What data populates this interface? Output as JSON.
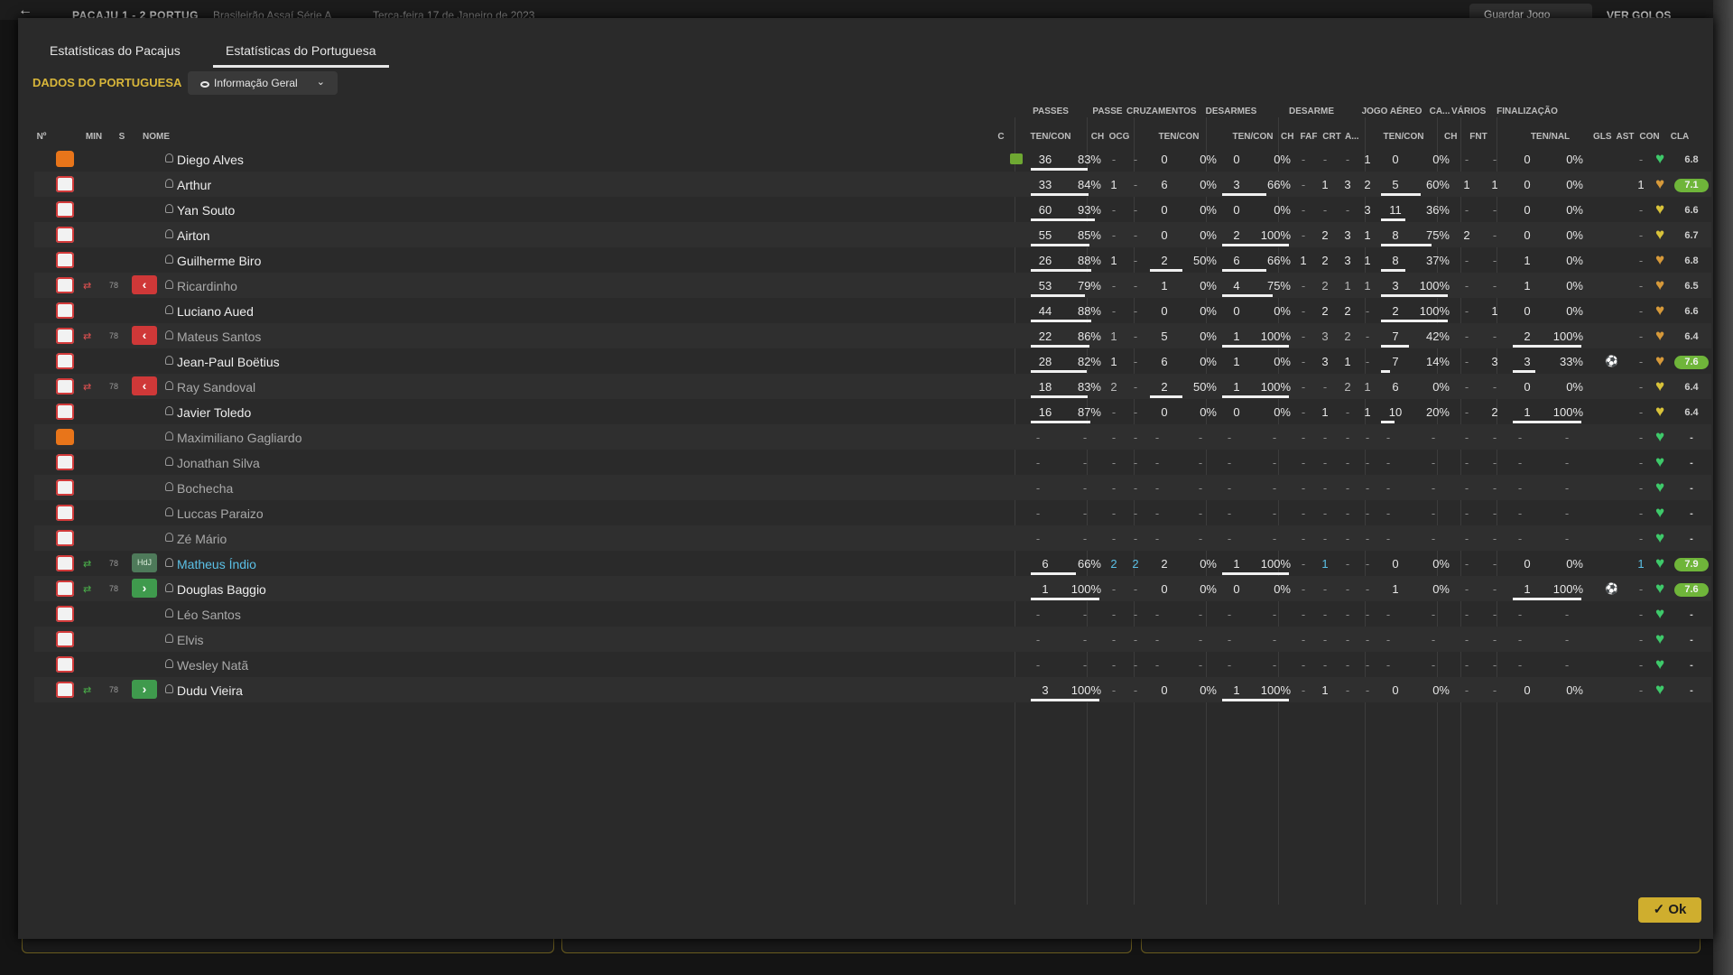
{
  "topbar": {
    "back_icon": "back-arrow-icon",
    "crumb": "PACAJU 1 - 2 PORTUG",
    "competition": "Brasileirão Assaí Série A",
    "date": "Terça-feira 17 de Janeiro de 2023",
    "save_label": "Guardar Jogo",
    "goals_label": "VER GOLOS"
  },
  "tabs": [
    {
      "label": "Estatísticas do Pacajus",
      "active": false
    },
    {
      "label": "Estatísticas do Portuguesa",
      "active": true
    }
  ],
  "team_label": "DADOS DO PORTUGUESA",
  "view_select": {
    "value": "Informação Geral"
  },
  "group_headers": [
    "PASSES",
    "PASSE",
    "CRUZAMENTOS",
    "DESARMES",
    "DESARME",
    "JOGO AÉREO",
    "CA...",
    "VÁRIOS",
    "FINALIZAÇÃO"
  ],
  "sub_headers": [
    "Nº",
    "MIN",
    "S",
    "NOME",
    "C",
    "TEN/CON",
    "CH",
    "OCG",
    "TEN/CON",
    "TEN/CON",
    "CH",
    "FAF",
    "CRT",
    "A...",
    "TEN/CON",
    "CH",
    "FNT",
    "TEN/NAL",
    "GLS",
    "AST",
    "CON",
    "CLA"
  ],
  "players": [
    {
      "name": "Diego Alves",
      "gk": true,
      "cond_icon": true,
      "pas": [
        "36",
        "83%",
        0.83
      ],
      "ch": "-",
      "ocg": "-",
      "cru": [
        "0",
        "0%",
        0
      ],
      "des": [
        "0",
        "0%",
        0
      ],
      "ds": [
        "-",
        "-",
        "-",
        "1"
      ],
      "aer": [
        "0",
        "0%",
        0
      ],
      "ca": "-",
      "fnt": "-",
      "fin": [
        "0",
        "0%",
        0
      ],
      "gls": "",
      "ast": "-",
      "heart": "g",
      "cla": "6.8"
    },
    {
      "name": "Arthur",
      "pas": [
        "33",
        "84%",
        0.84
      ],
      "ch": "1",
      "ocg": "-",
      "cru": [
        "6",
        "0%",
        0
      ],
      "des": [
        "3",
        "66%",
        0.66
      ],
      "ds": [
        "-",
        "1",
        "3",
        "2"
      ],
      "aer": [
        "5",
        "60%",
        0.6
      ],
      "ca": "1",
      "fnt": "1",
      "fin": [
        "0",
        "0%",
        0
      ],
      "gls": "",
      "ast": "1",
      "heart": "o",
      "cla": "7.1",
      "top": true
    },
    {
      "name": "Yan Souto",
      "pas": [
        "60",
        "93%",
        0.93
      ],
      "ch": "-",
      "ocg": "-",
      "cru": [
        "0",
        "0%",
        0
      ],
      "des": [
        "0",
        "0%",
        0
      ],
      "ds": [
        "-",
        "-",
        "-",
        "3"
      ],
      "aer": [
        "11",
        "36%",
        0.36
      ],
      "ca": "-",
      "fnt": "-",
      "fin": [
        "0",
        "0%",
        0
      ],
      "gls": "",
      "ast": "-",
      "heart": "y",
      "cla": "6.6"
    },
    {
      "name": "Airton",
      "pas": [
        "55",
        "85%",
        0.85
      ],
      "ch": "-",
      "ocg": "-",
      "cru": [
        "0",
        "0%",
        0
      ],
      "des": [
        "2",
        "100%",
        1
      ],
      "ds": [
        "-",
        "2",
        "3",
        "1"
      ],
      "aer": [
        "8",
        "75%",
        0.75
      ],
      "ca": "2",
      "fnt": "-",
      "fin": [
        "0",
        "0%",
        0
      ],
      "gls": "",
      "ast": "-",
      "heart": "y",
      "cla": "6.7"
    },
    {
      "name": "Guilherme Biro",
      "pas": [
        "26",
        "88%",
        0.88
      ],
      "ch": "1",
      "ocg": "-",
      "cru": [
        "2",
        "50%",
        0.5
      ],
      "des": [
        "6",
        "66%",
        0.66
      ],
      "ds": [
        "1",
        "2",
        "3",
        "1"
      ],
      "aer": [
        "8",
        "37%",
        0.37
      ],
      "ca": "-",
      "fnt": "-",
      "fin": [
        "1",
        "0%",
        0
      ],
      "gls": "",
      "ast": "-",
      "heart": "o",
      "cla": "6.8"
    },
    {
      "name": "Ricardinho",
      "dim": true,
      "sub": "out",
      "min": "78",
      "badge": "off",
      "pas": [
        "53",
        "79%",
        0.79
      ],
      "ch": "-",
      "ocg": "-",
      "cru": [
        "1",
        "0%",
        0
      ],
      "des": [
        "4",
        "75%",
        0.75
      ],
      "ds": [
        "-",
        "2",
        "1",
        "1"
      ],
      "aer": [
        "3",
        "100%",
        1
      ],
      "ca": "-",
      "fnt": "-",
      "fin": [
        "1",
        "0%",
        0
      ],
      "gls": "",
      "ast": "-",
      "heart": "o",
      "cla": "6.5"
    },
    {
      "name": "Luciano Aued",
      "pas": [
        "44",
        "88%",
        0.88
      ],
      "ch": "-",
      "ocg": "-",
      "cru": [
        "0",
        "0%",
        0
      ],
      "des": [
        "0",
        "0%",
        0
      ],
      "ds": [
        "-",
        "2",
        "2",
        "-"
      ],
      "aer": [
        "2",
        "100%",
        1
      ],
      "ca": "-",
      "fnt": "1",
      "fin": [
        "0",
        "0%",
        0
      ],
      "gls": "",
      "ast": "-",
      "heart": "o",
      "cla": "6.6"
    },
    {
      "name": "Mateus Santos",
      "dim": true,
      "sub": "out",
      "min": "78",
      "badge": "off",
      "pas": [
        "22",
        "86%",
        0.86
      ],
      "ch": "1",
      "ocg": "-",
      "cru": [
        "5",
        "0%",
        0
      ],
      "des": [
        "1",
        "100%",
        1
      ],
      "ds": [
        "-",
        "3",
        "2",
        "-"
      ],
      "aer": [
        "7",
        "42%",
        0.42
      ],
      "ca": "-",
      "fnt": "-",
      "fin": [
        "2",
        "100%",
        1
      ],
      "gls": "",
      "ast": "-",
      "heart": "o",
      "cla": "6.4"
    },
    {
      "name": "Jean-Paul Boëtius",
      "pas": [
        "28",
        "82%",
        0.82
      ],
      "ch": "1",
      "ocg": "-",
      "cru": [
        "6",
        "0%",
        0
      ],
      "des": [
        "1",
        "0%",
        0
      ],
      "ds": [
        "-",
        "3",
        "1",
        "-"
      ],
      "aer": [
        "7",
        "14%",
        0.14
      ],
      "ca": "-",
      "fnt": "3",
      "fin": [
        "3",
        "33%",
        0.33
      ],
      "gls": "⚽",
      "ast": "-",
      "heart": "o",
      "cla": "7.6",
      "top": true
    },
    {
      "name": "Ray Sandoval",
      "dim": true,
      "sub": "out",
      "min": "78",
      "badge": "off",
      "pas": [
        "18",
        "83%",
        0.83
      ],
      "ch": "2",
      "ocg": "-",
      "cru": [
        "2",
        "50%",
        0.5
      ],
      "des": [
        "1",
        "100%",
        1
      ],
      "ds": [
        "-",
        "-",
        "2",
        "1"
      ],
      "aer": [
        "6",
        "0%",
        0
      ],
      "ca": "-",
      "fnt": "-",
      "fin": [
        "0",
        "0%",
        0
      ],
      "gls": "",
      "ast": "-",
      "heart": "y",
      "cla": "6.4"
    },
    {
      "name": "Javier Toledo",
      "pas": [
        "16",
        "87%",
        0.87
      ],
      "ch": "-",
      "ocg": "-",
      "cru": [
        "0",
        "0%",
        0
      ],
      "des": [
        "0",
        "0%",
        0
      ],
      "ds": [
        "-",
        "1",
        "-",
        "1"
      ],
      "aer": [
        "10",
        "20%",
        0.2
      ],
      "ca": "-",
      "fnt": "2",
      "fin": [
        "1",
        "100%",
        1
      ],
      "gls": "",
      "ast": "-",
      "heart": "y",
      "cla": "6.4"
    },
    {
      "name": "Maximiliano Gagliardo",
      "gk": true,
      "dim": true,
      "empty": true,
      "heart": "g",
      "cla": "-"
    },
    {
      "name": "Jonathan Silva",
      "dim": true,
      "empty": true,
      "heart": "g",
      "cla": "-"
    },
    {
      "name": "Bochecha",
      "dim": true,
      "empty": true,
      "heart": "g",
      "cla": "-"
    },
    {
      "name": "Luccas Paraizo",
      "dim": true,
      "empty": true,
      "heart": "g",
      "cla": "-"
    },
    {
      "name": "Zé Mário",
      "dim": true,
      "empty": true,
      "heart": "g",
      "cla": "-"
    },
    {
      "name": "Matheus Índio",
      "hl": true,
      "sub": "in",
      "min": "78",
      "badge": "hdj",
      "badge_text": "HdJ",
      "blue": true,
      "pas": [
        "6",
        "66%",
        0.66
      ],
      "ch": "2",
      "ocg": "2",
      "cru": [
        "2",
        "0%",
        0
      ],
      "des": [
        "1",
        "100%",
        1
      ],
      "ds": [
        "-",
        "1",
        "-",
        "-"
      ],
      "aer": [
        "0",
        "0%",
        0
      ],
      "ca": "-",
      "fnt": "-",
      "fin": [
        "0",
        "0%",
        0
      ],
      "gls": "",
      "ast": "1",
      "heart": "g",
      "cla": "7.9",
      "top": true
    },
    {
      "name": "Douglas Baggio",
      "sub": "in",
      "min": "78",
      "badge": "on",
      "pas": [
        "1",
        "100%",
        1
      ],
      "ch": "-",
      "ocg": "-",
      "cru": [
        "0",
        "0%",
        0
      ],
      "des": [
        "0",
        "0%",
        0
      ],
      "ds": [
        "-",
        "-",
        "-",
        "-"
      ],
      "aer": [
        "1",
        "0%",
        0
      ],
      "ca": "-",
      "fnt": "-",
      "fin": [
        "1",
        "100%",
        1
      ],
      "gls": "⚽",
      "ast": "-",
      "heart": "g",
      "cla": "7.6",
      "top": true
    },
    {
      "name": "Léo Santos",
      "dim": true,
      "empty": true,
      "heart": "g",
      "cla": "-"
    },
    {
      "name": "Elvis",
      "dim": true,
      "empty": true,
      "heart": "g",
      "cla": "-"
    },
    {
      "name": "Wesley Natã",
      "dim": true,
      "empty": true,
      "heart": "g",
      "cla": "-"
    },
    {
      "name": "Dudu Vieira",
      "sub": "in",
      "min": "78",
      "badge": "on",
      "pas": [
        "3",
        "100%",
        1
      ],
      "ch": "-",
      "ocg": "-",
      "cru": [
        "0",
        "0%",
        0
      ],
      "des": [
        "1",
        "100%",
        1
      ],
      "ds": [
        "-",
        "1",
        "-",
        "-"
      ],
      "aer": [
        "0",
        "0%",
        0
      ],
      "ca": "-",
      "fnt": "-",
      "fin": [
        "0",
        "0%",
        0
      ],
      "gls": "",
      "ast": "-",
      "heart": "g",
      "cla": "-"
    }
  ],
  "ok_label": "Ok",
  "colors": {
    "accent": "#d8b63a",
    "sub_out": "#cf3838",
    "sub_in": "#3f9a4d",
    "highlight": "#5bc0e6",
    "rating_top": "#6fb53a"
  }
}
